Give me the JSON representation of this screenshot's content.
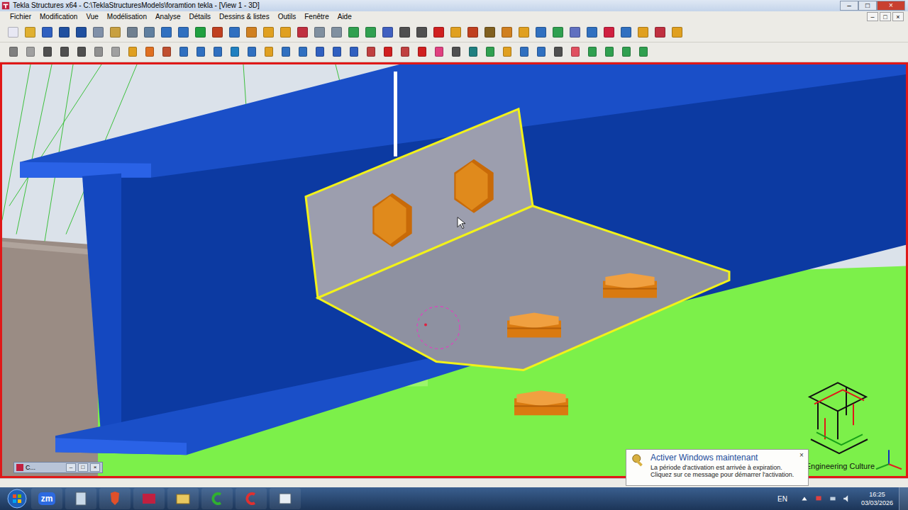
{
  "window": {
    "title": "Tekla Structures x64 - C:\\TeklaStructuresModels\\foramtion tekla - [View 1 - 3D]",
    "controls": [
      "–",
      "□",
      "×"
    ]
  },
  "menu": {
    "items": [
      "Fichier",
      "Modification",
      "Vue",
      "Modélisation",
      "Analyse",
      "Détails",
      "Dessins & listes",
      "Outils",
      "Fenêtre",
      "Aide"
    ],
    "view_controls": [
      "–",
      "□",
      "×"
    ]
  },
  "viewport": {
    "watermark": "Engineering Culture"
  },
  "minimized_window": {
    "label": "C...",
    "controls": [
      "–",
      "□",
      "×"
    ]
  },
  "notification": {
    "title": "Activer Windows maintenant",
    "lines": [
      "La période d'activation est arrivée à expiration.",
      "Cliquez sur ce message pour démarrer l'activation."
    ],
    "close": "×"
  },
  "taskbar": {
    "apps": [
      {
        "kind": "zoom",
        "label": "zm"
      },
      {
        "kind": "calculator"
      },
      {
        "kind": "browser"
      },
      {
        "kind": "tekla"
      },
      {
        "kind": "explorer"
      },
      {
        "kind": "green-app"
      },
      {
        "kind": "red-app"
      },
      {
        "kind": "window"
      }
    ],
    "language": "EN",
    "time": "16:25",
    "date": "03/03/2026"
  }
}
